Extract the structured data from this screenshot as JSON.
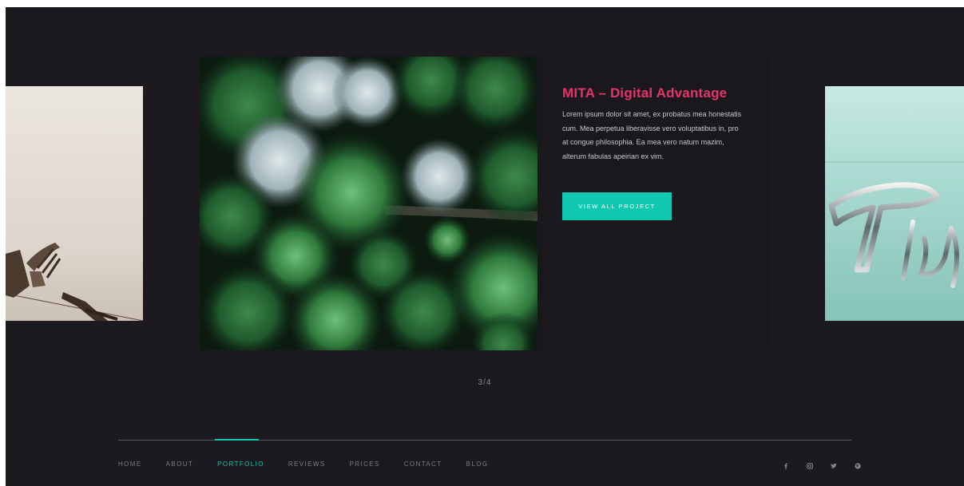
{
  "slider": {
    "active_slide": {
      "title": "MITA – Digital Advantage",
      "description": "Lorem ipsum dolor sit amet, ex probatus mea honestatis cum. Mea perpetua liberavisse vero voluptatibus in, pro at congue philosophia. Ea mea vero natum mazim, alterum fabulas apeirian ex vim.",
      "cta_label": "VIEW ALL PROJECT"
    },
    "counter": "3/4"
  },
  "footer": {
    "nav": [
      {
        "label": "HOME"
      },
      {
        "label": "ABOUT"
      },
      {
        "label": "PORTFOLIO",
        "active": true
      },
      {
        "label": "REVIEWS"
      },
      {
        "label": "PRICES"
      },
      {
        "label": "CONTACT"
      },
      {
        "label": "BLOG"
      }
    ],
    "social_icons": [
      "facebook-icon",
      "instagram-icon",
      "twitter-icon",
      "pinterest-icon"
    ]
  },
  "colors": {
    "background": "#1c1a1f",
    "accent": "#10c8b0",
    "title_pink": "#e8336a"
  }
}
